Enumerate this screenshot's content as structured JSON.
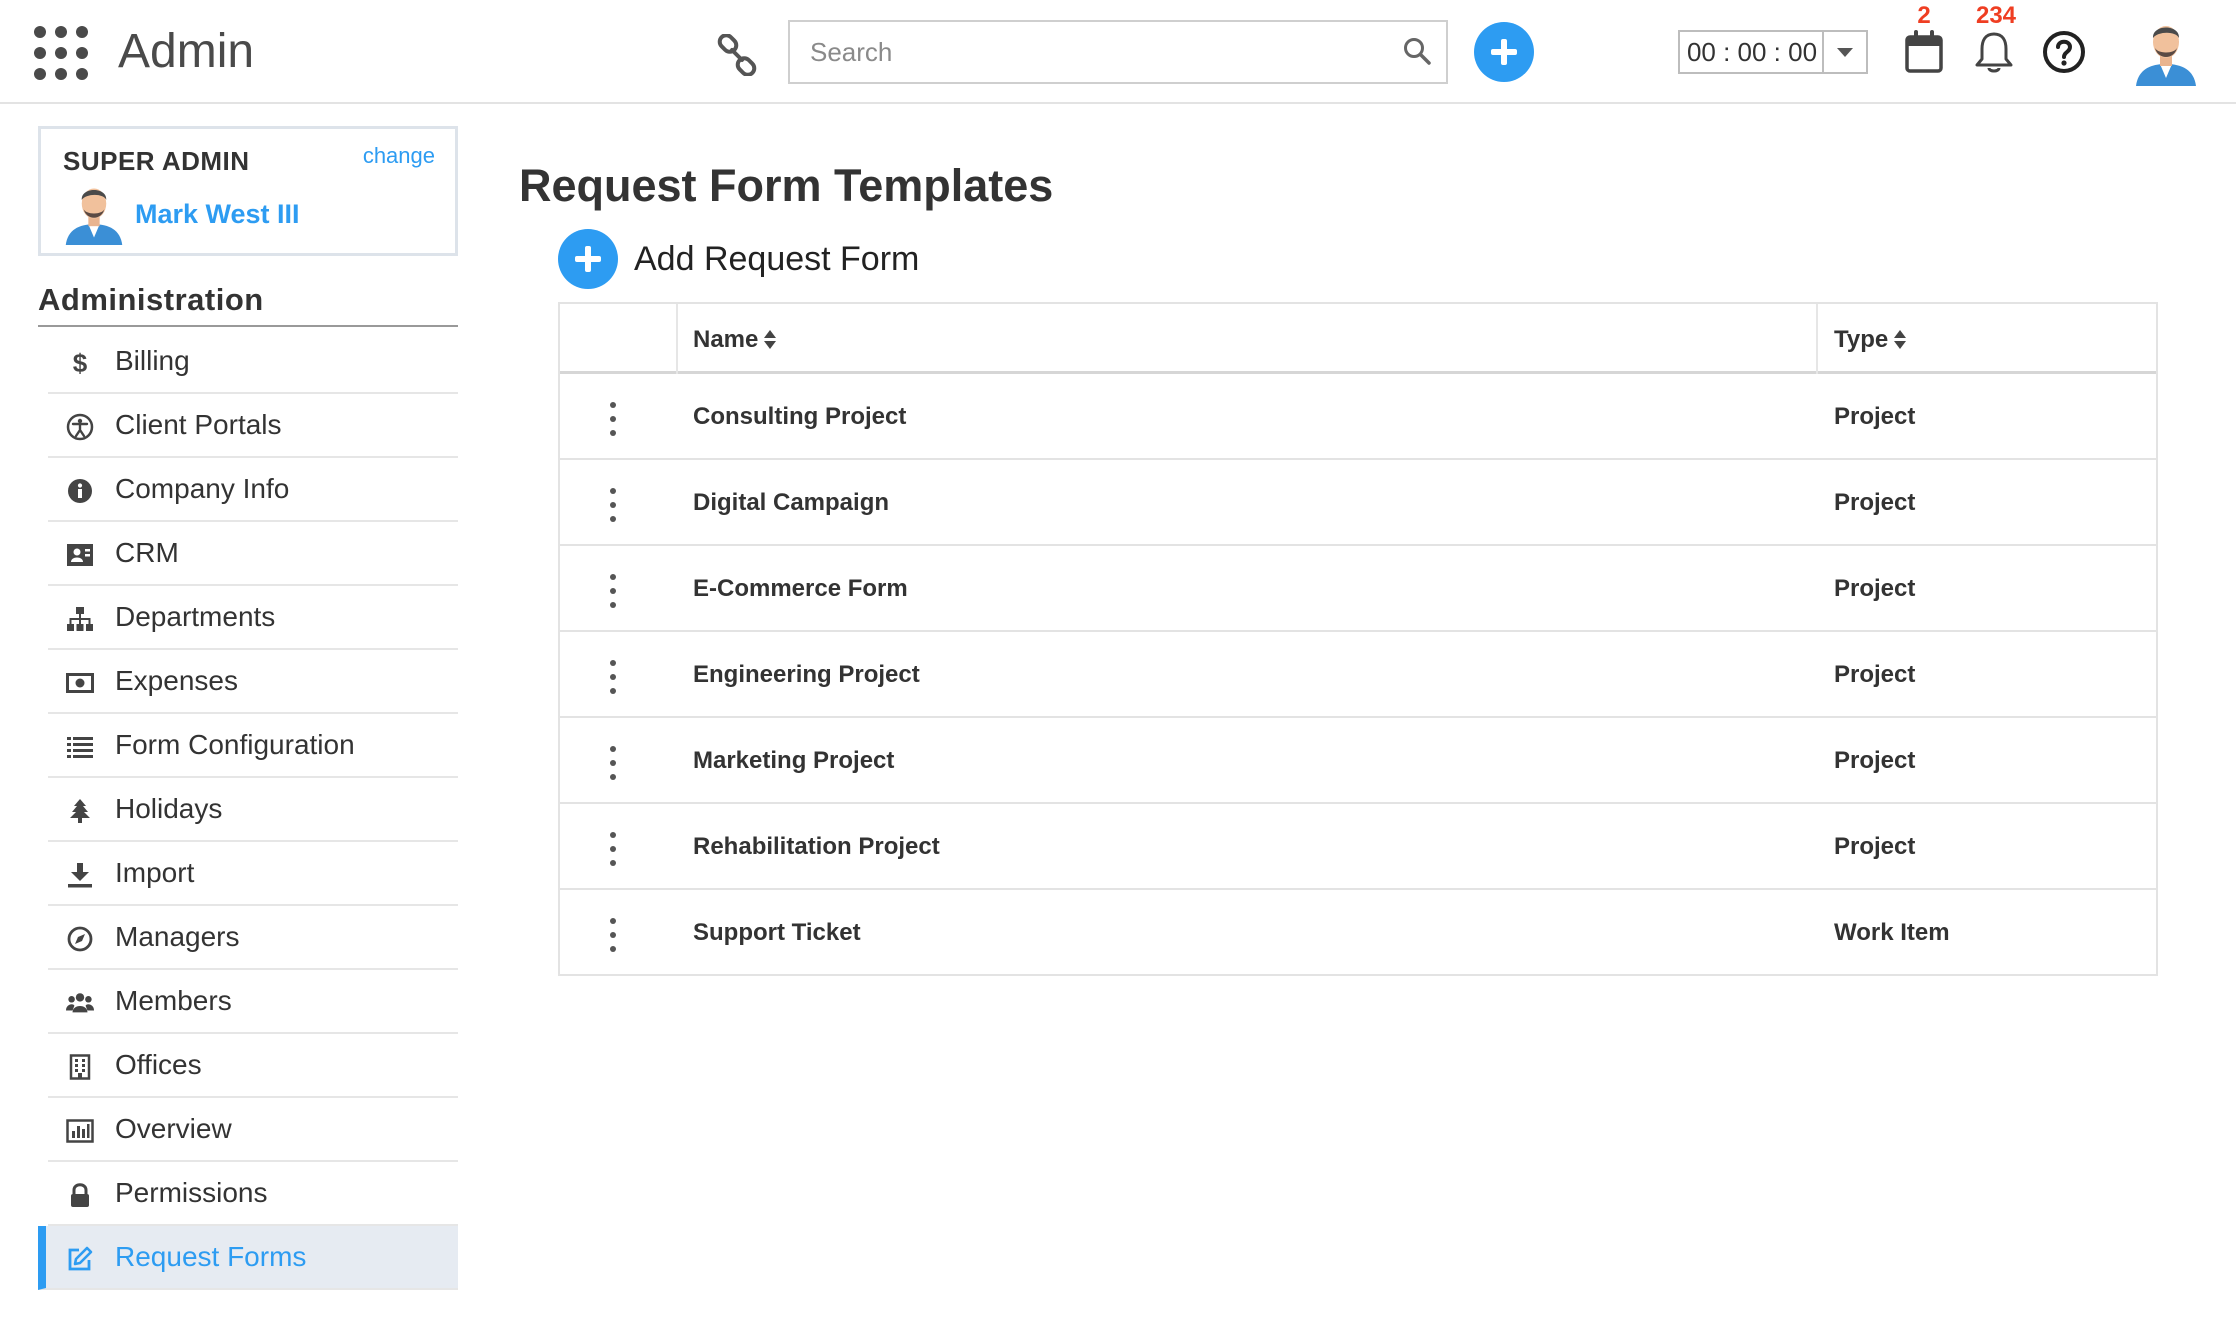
{
  "header": {
    "app_title": "Admin",
    "search_placeholder": "Search",
    "timer_value": "00 : 00 : 00",
    "calendar_badge": "2",
    "notifications_badge": "234",
    "accent_color": "#2d9cf2",
    "badge_color": "#ef3e22"
  },
  "profile": {
    "role": "SUPER ADMIN",
    "change_label": "change",
    "user_name": "Mark West III"
  },
  "sidebar": {
    "section_title": "Administration",
    "items": [
      {
        "label": "Billing",
        "icon": "dollar-icon"
      },
      {
        "label": "Client Portals",
        "icon": "accessibility-icon"
      },
      {
        "label": "Company Info",
        "icon": "info-icon"
      },
      {
        "label": "CRM",
        "icon": "contact-card-icon"
      },
      {
        "label": "Departments",
        "icon": "org-chart-icon"
      },
      {
        "label": "Expenses",
        "icon": "money-icon"
      },
      {
        "label": "Form Configuration",
        "icon": "list-icon"
      },
      {
        "label": "Holidays",
        "icon": "tree-icon"
      },
      {
        "label": "Import",
        "icon": "download-icon"
      },
      {
        "label": "Managers",
        "icon": "compass-icon"
      },
      {
        "label": "Members",
        "icon": "users-icon"
      },
      {
        "label": "Offices",
        "icon": "building-icon"
      },
      {
        "label": "Overview",
        "icon": "bar-chart-icon"
      },
      {
        "label": "Permissions",
        "icon": "lock-icon"
      },
      {
        "label": "Request Forms",
        "icon": "edit-icon",
        "active": true
      }
    ]
  },
  "main": {
    "page_title": "Request Form Templates",
    "add_label": "Add Request Form",
    "columns": {
      "name": "Name",
      "type": "Type"
    },
    "rows": [
      {
        "name": "Consulting Project",
        "type": "Project"
      },
      {
        "name": "Digital Campaign",
        "type": "Project"
      },
      {
        "name": "E-Commerce Form",
        "type": "Project"
      },
      {
        "name": "Engineering Project",
        "type": "Project"
      },
      {
        "name": "Marketing Project",
        "type": "Project"
      },
      {
        "name": "Rehabilitation Project",
        "type": "Project"
      },
      {
        "name": "Support Ticket",
        "type": "Work Item"
      }
    ]
  }
}
